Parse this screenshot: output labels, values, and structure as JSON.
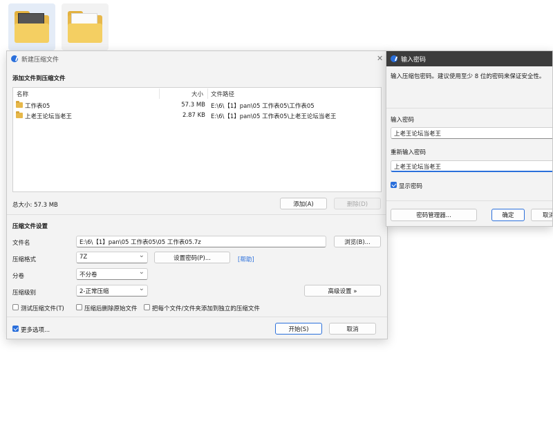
{
  "main_dialog": {
    "title": "新建压缩文件",
    "close_glyph": "✕",
    "add_section_title": "添加文件到压缩文件",
    "columns": {
      "name": "名称",
      "size": "大小",
      "path": "文件路径"
    },
    "files": [
      {
        "name": "工作表05",
        "size": "57.3 MB",
        "path": "E:\\6\\【1】pan\\05 工作表05\\工作表05"
      },
      {
        "name": "上老王论坛当老王",
        "size": "2.87 KB",
        "path": "E:\\6\\【1】pan\\05 工作表05\\上老王论坛当老王"
      }
    ],
    "total_size": "总大小: 57.3 MB",
    "add_button": "添加(A)",
    "delete_button": "删除(D)",
    "settings_title": "压缩文件设置",
    "filename_label": "文件名",
    "filename_value": "E:\\6\\【1】pan\\05 工作表05\\05 工作表05.7z",
    "browse_button": "浏览(B)...",
    "format_label": "压缩格式",
    "format_value": "7Z",
    "set_password_button": "设置密码(P)...",
    "help_link": "[帮助]",
    "split_label": "分卷",
    "split_value": "不分卷",
    "level_label": "压缩级别",
    "level_value": "2-正常压缩",
    "advanced_button": "高级设置 »",
    "opt_test": "测试压缩文件(T)",
    "opt_delete_after": "压缩后删除原始文件",
    "opt_separate": "把每个文件/文件夹添加到独立的压缩文件",
    "more_options": "更多选项...",
    "start_button": "开始(S)",
    "cancel_button": "取消"
  },
  "password_dialog": {
    "title": "输入密码",
    "hint": "输入压缩包密码。建议使用至少 8 位的密码来保证安全性。",
    "password_label": "输入密码",
    "password_value": "上老王论坛当老王",
    "confirm_label": "重新输入密码",
    "confirm_value": "上老王论坛当老王",
    "show_password": "显示密码",
    "manager_button": "密码管理器...",
    "ok_button": "确定",
    "cancel_button": "取消"
  }
}
